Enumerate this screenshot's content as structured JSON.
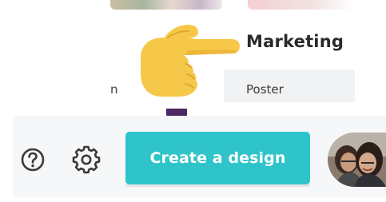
{
  "categories_panel": {
    "cropped_label": "n",
    "heading": "Marketing",
    "item": "Poster",
    "hand_icon": "pointing-hand-emoji"
  },
  "toolbar": {
    "help_icon": "question-circle-icon",
    "settings_icon": "gear-icon",
    "create_button_label": "Create a design",
    "avatar": "user-avatar"
  },
  "colors": {
    "accent": "#2ec4c9",
    "hand": "#f6c84a",
    "purple_dot": "#4b2a63",
    "toolbar_bg": "#f6f7f8",
    "panel_band": "#f1f2f4"
  }
}
